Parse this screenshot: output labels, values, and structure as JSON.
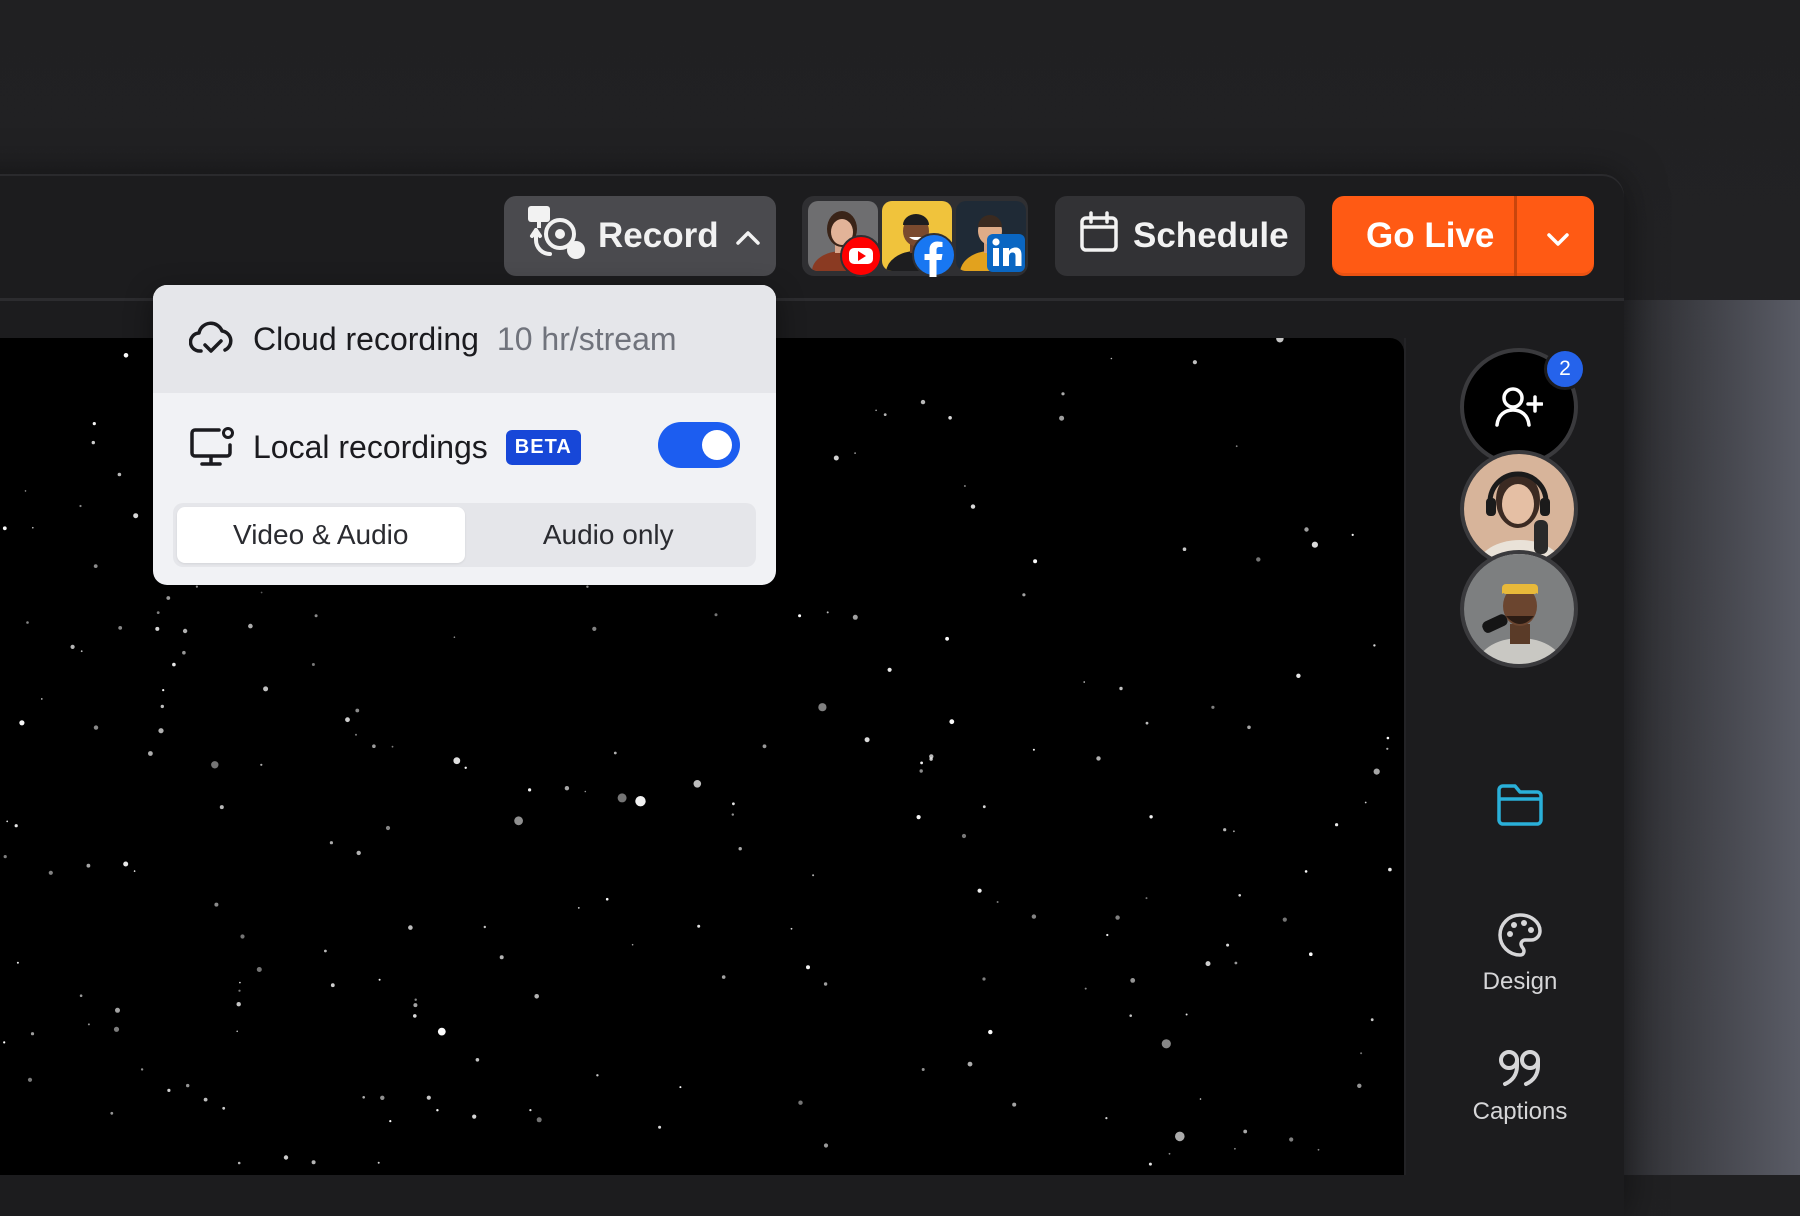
{
  "toolbar": {
    "record_label": "Record",
    "schedule_label": "Schedule",
    "go_live_label": "Go Live",
    "destinations": [
      {
        "platform_icon": "youtube-icon"
      },
      {
        "platform_icon": "facebook-icon"
      },
      {
        "platform_icon": "linkedin-icon"
      }
    ]
  },
  "record_menu": {
    "cloud_recording": {
      "label": "Cloud recording",
      "limit": "10 hr/stream"
    },
    "local_recordings": {
      "label": "Local recordings",
      "badge": "BETA",
      "enabled": true
    },
    "mode_options": [
      "Video & Audio",
      "Audio only"
    ],
    "selected_mode": "Video & Audio"
  },
  "right_rail": {
    "invite_count": "2",
    "design_label": "Design",
    "captions_label": "Captions"
  },
  "colors": {
    "go_live": "#ff5a14",
    "toggle_on": "#1c5df0",
    "beta_badge": "#1747d8",
    "folder_icon": "#2ab0d9",
    "count_badge": "#2563eb"
  }
}
